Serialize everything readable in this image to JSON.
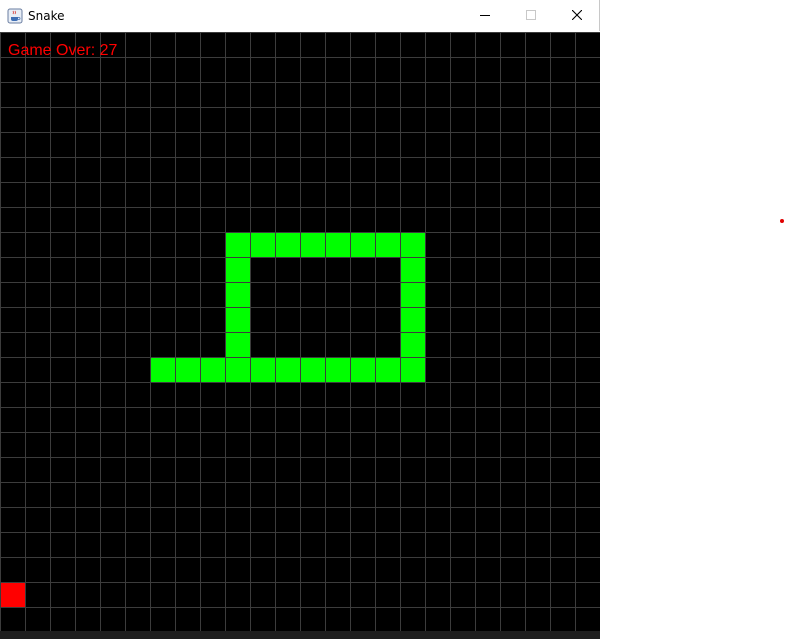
{
  "window": {
    "title": "Snake",
    "icon": "java-cup-icon"
  },
  "game": {
    "status_text": "Game Over: 27",
    "grid": {
      "cols": 24,
      "rows": 24,
      "cell_size": 25
    },
    "snake_cells": [
      [
        9,
        8
      ],
      [
        10,
        8
      ],
      [
        11,
        8
      ],
      [
        12,
        8
      ],
      [
        13,
        8
      ],
      [
        14,
        8
      ],
      [
        15,
        8
      ],
      [
        16,
        8
      ],
      [
        9,
        9
      ],
      [
        16,
        9
      ],
      [
        9,
        10
      ],
      [
        16,
        10
      ],
      [
        9,
        11
      ],
      [
        16,
        11
      ],
      [
        9,
        12
      ],
      [
        16,
        12
      ],
      [
        6,
        13
      ],
      [
        7,
        13
      ],
      [
        8,
        13
      ],
      [
        9,
        13
      ],
      [
        10,
        13
      ],
      [
        11,
        13
      ],
      [
        12,
        13
      ],
      [
        13,
        13
      ],
      [
        14,
        13
      ],
      [
        15,
        13
      ],
      [
        16,
        13
      ]
    ],
    "food_cell": [
      0,
      22
    ]
  },
  "colors": {
    "background": "#000000",
    "grid_line": "#3c3c3c",
    "snake": "#00ff00",
    "snake_outline": "#00c800",
    "food": "#ff0000",
    "status_text": "#ff0000",
    "accent_dot": "#e00000"
  }
}
